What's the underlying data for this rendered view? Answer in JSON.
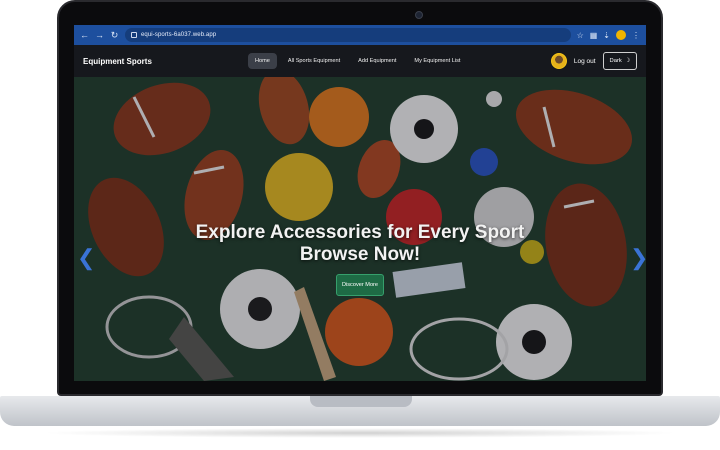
{
  "browser": {
    "url": "equi-sports-6a037.web.app",
    "back_icon": "arrow-left-icon",
    "forward_icon": "arrow-right-icon",
    "reload_icon": "reload-icon"
  },
  "navbar": {
    "brand": "Equipment Sports",
    "links": [
      {
        "label": "Home",
        "active": true
      },
      {
        "label": "All Sports Equipment",
        "active": false
      },
      {
        "label": "Add Equipment",
        "active": false
      },
      {
        "label": "My Equipment List",
        "active": false
      }
    ],
    "logout_label": "Log out",
    "theme_label": "Dark",
    "theme_icon": "moon-icon"
  },
  "hero": {
    "title_line1": "Explore Accessories for Every Sport",
    "title_line2": "Browse Now!",
    "cta_label": "Discover More",
    "prev_icon": "chevron-left-icon",
    "next_icon": "chevron-right-icon"
  },
  "colors": {
    "browser_bar": "#1d4f9e",
    "navbar_bg": "#16181d",
    "cta_bg": "#1e6b45",
    "carousel_arrow": "#3a73d6"
  }
}
